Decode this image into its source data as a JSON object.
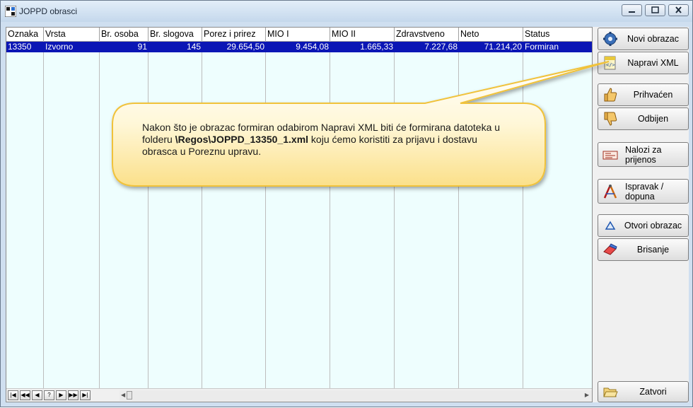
{
  "window": {
    "title": "JOPPD obrasci"
  },
  "grid": {
    "columns": [
      {
        "label": "Oznaka"
      },
      {
        "label": "Vrsta"
      },
      {
        "label": "Br. osoba"
      },
      {
        "label": "Br. slogova"
      },
      {
        "label": "Porez i prirez"
      },
      {
        "label": "MIO I"
      },
      {
        "label": "MIO II"
      },
      {
        "label": "Zdravstveno"
      },
      {
        "label": "Neto"
      },
      {
        "label": "Status"
      }
    ],
    "rows": [
      [
        "13350",
        "Izvorno",
        "91",
        "145",
        "29.654,50",
        "9.454,08",
        "1.665,33",
        "7.227,68",
        "71.214,20",
        "Formiran"
      ]
    ]
  },
  "nav": {
    "first": "|◀",
    "prev_page": "◀◀",
    "prev": "◀",
    "help": "?",
    "next": "▶",
    "next_page": "▶▶",
    "last": "▶|"
  },
  "buttons": {
    "new_form": "Novi obrazac",
    "make_xml": "Napravi XML",
    "accepted": "Prihvaćen",
    "rejected": "Odbijen",
    "payment_orders": "Nalozi za prijenos",
    "correction": "Ispravak / dopuna",
    "open_form": "Otvori obrazac",
    "delete": "Brisanje",
    "close": "Zatvori"
  },
  "callout": {
    "part1": "Nakon što je obrazac formiran  odabirom Napravi XML biti će formirana datoteka u folderu ",
    "path": "\\Regos\\JOPPD_13350_1.xml",
    "part2": "  koju ćemo koristiti za prijavu i dostavu obrasca u Poreznu upravu."
  }
}
